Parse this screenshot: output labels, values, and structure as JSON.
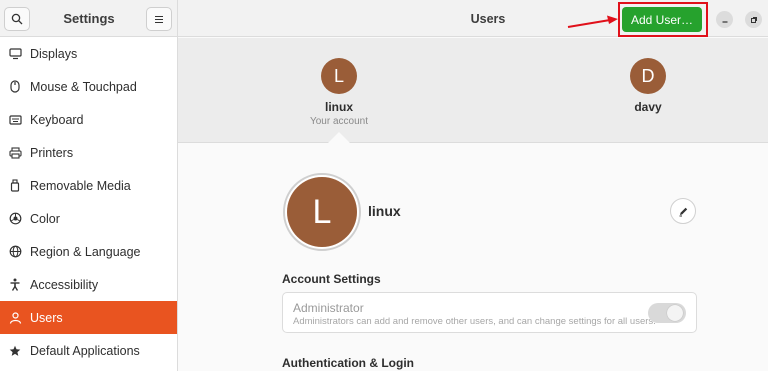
{
  "sidebar": {
    "title": "Settings",
    "items": [
      {
        "label": "Displays",
        "icon": "display-icon"
      },
      {
        "label": "Mouse & Touchpad",
        "icon": "mouse-icon"
      },
      {
        "label": "Keyboard",
        "icon": "keyboard-icon"
      },
      {
        "label": "Printers",
        "icon": "printer-icon"
      },
      {
        "label": "Removable Media",
        "icon": "removable-media-icon"
      },
      {
        "label": "Color",
        "icon": "color-icon"
      },
      {
        "label": "Region & Language",
        "icon": "globe-icon"
      },
      {
        "label": "Accessibility",
        "icon": "accessibility-icon"
      },
      {
        "label": "Users",
        "icon": "users-icon",
        "active": true
      },
      {
        "label": "Default Applications",
        "icon": "star-icon"
      }
    ]
  },
  "header": {
    "title": "Users",
    "add_user_label": "Add User…",
    "accent_color": "#26a22d",
    "highlight_color": "#e0101a"
  },
  "carousel": {
    "users": [
      {
        "initial": "L",
        "name": "linux",
        "subtitle": "Your account"
      },
      {
        "initial": "D",
        "name": "davy",
        "subtitle": ""
      }
    ]
  },
  "profile": {
    "initial": "L",
    "name": "linux"
  },
  "account_settings": {
    "title": "Account Settings",
    "administrator_label": "Administrator",
    "administrator_desc": "Administrators can add and remove other users, and can change settings for all users.",
    "administrator_enabled": false
  },
  "auth": {
    "title": "Authentication & Login"
  },
  "colors": {
    "active_item": "#e95420",
    "avatar": "#9a5d38"
  }
}
